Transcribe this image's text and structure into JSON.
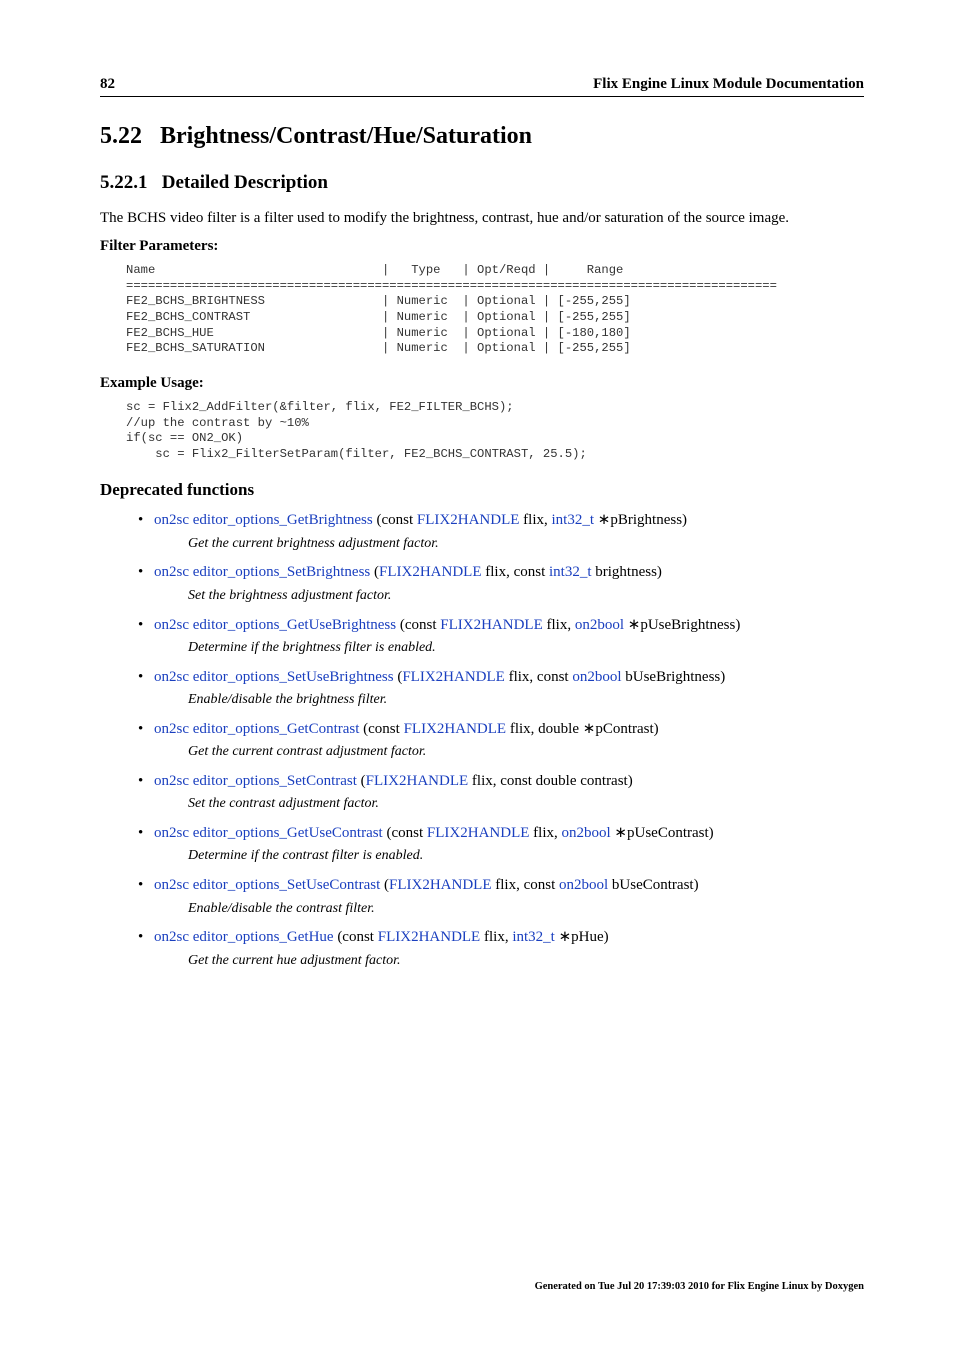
{
  "header": {
    "page_number": "82",
    "doc_title": "Flix Engine Linux Module Documentation"
  },
  "section": {
    "number": "5.22",
    "title": "Brightness/Contrast/Hue/Saturation"
  },
  "subsection": {
    "number": "5.22.1",
    "title": "Detailed Description"
  },
  "intro": "The BCHS video filter is a filter used to modify the brightness, contrast, hue and/or saturation of the source image.",
  "filter_params_label": "Filter Parameters:",
  "filter_params_code": "Name                               |   Type   | Opt/Reqd |     Range\n=========================================================================================\nFE2_BCHS_BRIGHTNESS                | Numeric  | Optional | [-255,255]\nFE2_BCHS_CONTRAST                  | Numeric  | Optional | [-255,255]\nFE2_BCHS_HUE                       | Numeric  | Optional | [-180,180]\nFE2_BCHS_SATURATION                | Numeric  | Optional | [-255,255]",
  "example_label": "Example Usage:",
  "example_code": "sc = Flix2_AddFilter(&filter, flix, FE2_FILTER_BCHS);\n//up the contrast by ~10%\nif(sc == ON2_OK)\n    sc = Flix2_FilterSetParam(filter, FE2_BCHS_CONTRAST, 25.5);",
  "deprecated_title": "Deprecated functions",
  "functions": [
    {
      "sig_parts": [
        {
          "t": "link",
          "v": "on2sc"
        },
        {
          "t": "txt",
          "v": " "
        },
        {
          "t": "link",
          "v": "editor_options_GetBrightness"
        },
        {
          "t": "txt",
          "v": " (const "
        },
        {
          "t": "link",
          "v": "FLIX2HANDLE"
        },
        {
          "t": "txt",
          "v": " flix, "
        },
        {
          "t": "link",
          "v": "int32_t"
        },
        {
          "t": "txt",
          "v": " "
        },
        {
          "t": "ast",
          "v": "∗"
        },
        {
          "t": "txt",
          "v": "pBrightness)"
        }
      ],
      "desc": "Get the current brightness adjustment factor."
    },
    {
      "sig_parts": [
        {
          "t": "link",
          "v": "on2sc"
        },
        {
          "t": "txt",
          "v": " "
        },
        {
          "t": "link",
          "v": "editor_options_SetBrightness"
        },
        {
          "t": "txt",
          "v": " ("
        },
        {
          "t": "link",
          "v": "FLIX2HANDLE"
        },
        {
          "t": "txt",
          "v": " flix, const "
        },
        {
          "t": "link",
          "v": "int32_t"
        },
        {
          "t": "txt",
          "v": " brightness)"
        }
      ],
      "desc": "Set the brightness adjustment factor."
    },
    {
      "sig_parts": [
        {
          "t": "link",
          "v": "on2sc"
        },
        {
          "t": "txt",
          "v": " "
        },
        {
          "t": "link",
          "v": "editor_options_GetUseBrightness"
        },
        {
          "t": "txt",
          "v": " (const "
        },
        {
          "t": "link",
          "v": "FLIX2HANDLE"
        },
        {
          "t": "txt",
          "v": " flix, "
        },
        {
          "t": "link",
          "v": "on2bool"
        },
        {
          "t": "txt",
          "v": " "
        },
        {
          "t": "ast",
          "v": "∗"
        },
        {
          "t": "txt",
          "v": "pUseBrightness)"
        }
      ],
      "desc": "Determine if the brightness filter is enabled."
    },
    {
      "sig_parts": [
        {
          "t": "link",
          "v": "on2sc"
        },
        {
          "t": "txt",
          "v": " "
        },
        {
          "t": "link",
          "v": "editor_options_SetUseBrightness"
        },
        {
          "t": "txt",
          "v": " ("
        },
        {
          "t": "link",
          "v": "FLIX2HANDLE"
        },
        {
          "t": "txt",
          "v": " flix, const "
        },
        {
          "t": "link",
          "v": "on2bool"
        },
        {
          "t": "txt",
          "v": " bUseBrightness)"
        }
      ],
      "desc": "Enable/disable the brightness filter."
    },
    {
      "sig_parts": [
        {
          "t": "link",
          "v": "on2sc"
        },
        {
          "t": "txt",
          "v": " "
        },
        {
          "t": "link",
          "v": "editor_options_GetContrast"
        },
        {
          "t": "txt",
          "v": " (const "
        },
        {
          "t": "link",
          "v": "FLIX2HANDLE"
        },
        {
          "t": "txt",
          "v": " flix, double "
        },
        {
          "t": "ast",
          "v": "∗"
        },
        {
          "t": "txt",
          "v": "pContrast)"
        }
      ],
      "desc": "Get the current contrast adjustment factor."
    },
    {
      "sig_parts": [
        {
          "t": "link",
          "v": "on2sc"
        },
        {
          "t": "txt",
          "v": " "
        },
        {
          "t": "link",
          "v": "editor_options_SetContrast"
        },
        {
          "t": "txt",
          "v": " ("
        },
        {
          "t": "link",
          "v": "FLIX2HANDLE"
        },
        {
          "t": "txt",
          "v": " flix, const double contrast)"
        }
      ],
      "desc": "Set the contrast adjustment factor."
    },
    {
      "sig_parts": [
        {
          "t": "link",
          "v": "on2sc"
        },
        {
          "t": "txt",
          "v": " "
        },
        {
          "t": "link",
          "v": "editor_options_GetUseContrast"
        },
        {
          "t": "txt",
          "v": " (const "
        },
        {
          "t": "link",
          "v": "FLIX2HANDLE"
        },
        {
          "t": "txt",
          "v": " flix, "
        },
        {
          "t": "link",
          "v": "on2bool"
        },
        {
          "t": "txt",
          "v": " "
        },
        {
          "t": "ast",
          "v": "∗"
        },
        {
          "t": "txt",
          "v": "pUseContrast)"
        }
      ],
      "desc": "Determine if the contrast filter is enabled."
    },
    {
      "sig_parts": [
        {
          "t": "link",
          "v": "on2sc"
        },
        {
          "t": "txt",
          "v": " "
        },
        {
          "t": "link",
          "v": "editor_options_SetUseContrast"
        },
        {
          "t": "txt",
          "v": " ("
        },
        {
          "t": "link",
          "v": "FLIX2HANDLE"
        },
        {
          "t": "txt",
          "v": " flix, const "
        },
        {
          "t": "link",
          "v": "on2bool"
        },
        {
          "t": "txt",
          "v": " bUseContrast)"
        }
      ],
      "desc": "Enable/disable the contrast filter."
    },
    {
      "sig_parts": [
        {
          "t": "link",
          "v": "on2sc"
        },
        {
          "t": "txt",
          "v": " "
        },
        {
          "t": "link",
          "v": "editor_options_GetHue"
        },
        {
          "t": "txt",
          "v": " (const "
        },
        {
          "t": "link",
          "v": "FLIX2HANDLE"
        },
        {
          "t": "txt",
          "v": " flix, "
        },
        {
          "t": "link",
          "v": "int32_t"
        },
        {
          "t": "txt",
          "v": " "
        },
        {
          "t": "ast",
          "v": "∗"
        },
        {
          "t": "txt",
          "v": "pHue)"
        }
      ],
      "desc": "Get the current hue adjustment factor."
    }
  ],
  "footer": "Generated on Tue Jul 20 17:39:03 2010 for Flix Engine Linux by Doxygen"
}
